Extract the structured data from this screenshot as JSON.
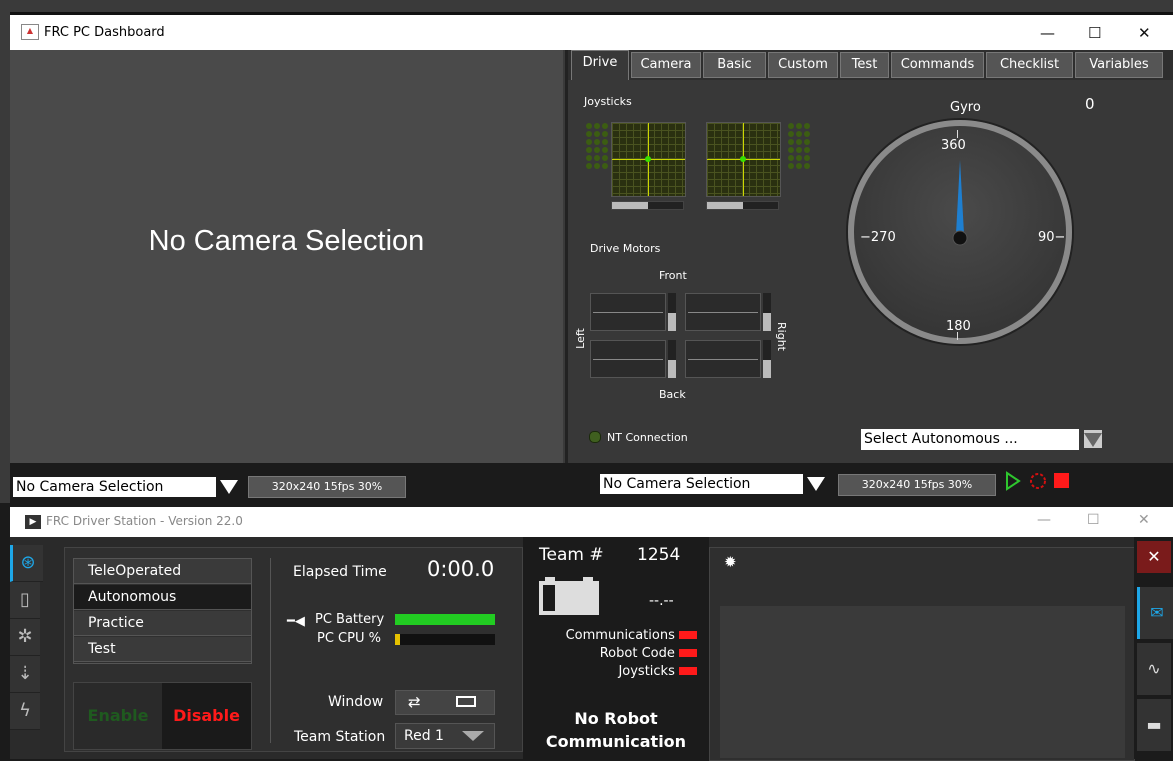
{
  "dashboard": {
    "title": "FRC PC Dashboard",
    "window_controls": {
      "minimize": "—",
      "maximize": "☐",
      "close": "✕"
    },
    "left_camera": {
      "placeholder_text": "No Camera Selection",
      "selection": "No Camera Selection",
      "resolution_button": "320x240  15fps  30%"
    },
    "tabs": [
      "Drive",
      "Camera",
      "Basic",
      "Custom",
      "Test",
      "Commands",
      "Checklist",
      "Variables"
    ],
    "active_tab": "Drive",
    "drive": {
      "joysticks_label": "Joysticks",
      "drive_motors_label": "Drive Motors",
      "front_label": "Front",
      "back_label": "Back",
      "left_label": "Left",
      "right_label": "Right",
      "nt_connection_label": "NT Connection",
      "autonomous_select": "Select Autonomous ...",
      "gyro": {
        "label": "Gyro",
        "value": "0",
        "tick_360": "360",
        "tick_90": "90",
        "tick_180": "180",
        "tick_270": "270"
      }
    },
    "right_camera": {
      "selection": "No Camera Selection",
      "resolution_button": "320x240  15fps  30%"
    },
    "colors": {
      "play": "#2ec62e",
      "stop": "#ff1a1a",
      "accent": "#1e90ff"
    }
  },
  "driver_station": {
    "title": "FRC Driver Station - Version 22.0",
    "modes": [
      "TeleOperated",
      "Autonomous",
      "Practice",
      "Test"
    ],
    "selected_mode": "Autonomous",
    "enable_label": "Enable",
    "disable_label": "Disable",
    "elapsed_time_label": "Elapsed Time",
    "elapsed_time": "0:00.0",
    "pc_battery_label": "PC Battery",
    "pc_cpu_label": "PC CPU %",
    "pc_battery_level": 1.0,
    "pc_cpu_level": 0.05,
    "window_label": "Window",
    "team_station_label": "Team Station",
    "team_station_value": "Red 1",
    "team_label": "Team #",
    "team_number": "1254",
    "battery_voltage": "--.--",
    "indicators": [
      "Communications",
      "Robot Code",
      "Joysticks"
    ],
    "status_line1": "No Robot",
    "status_line2": "Communication"
  }
}
